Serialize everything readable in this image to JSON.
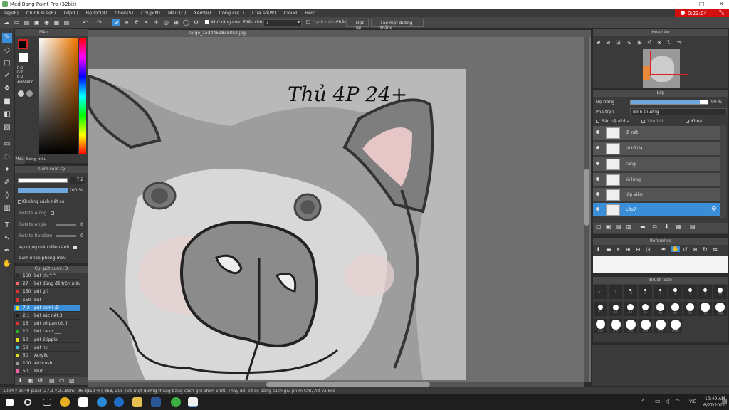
{
  "window": {
    "title": "MediBang Paint Pro (32bit)",
    "minimize": "–",
    "maximize": "□",
    "close": "✕"
  },
  "menu": [
    "Tệp(F)",
    "Chỉnh sửa(E)",
    "Lớp(L)",
    "Bộ lọc(R)",
    "Chọn(S)",
    "Chụp(N)",
    "Màu (C)",
    "Xem(V)",
    "Công cụ(T)",
    "Cửa sổ(W)",
    "Cloud",
    "Help"
  ],
  "recorder": {
    "time": "0:23:04"
  },
  "toolbar": {
    "anti_alias": "Khử răng cưa",
    "correction_label": "Điều chỉnh",
    "correction_value": "1",
    "edge": "Cạnh mềm",
    "pen_label": "Phẩn",
    "fill_label": "Đặt lại",
    "ruler_btn": "Tạo một đường thẳng"
  },
  "sheet": {
    "tab": "large_1524452835852.jpg"
  },
  "color_panel": {
    "title": "Màu",
    "r": "R:0",
    "g": "G:0",
    "b": "B:0",
    "hex": "#000000",
    "tab_color": "Màu",
    "tab_palette": "Bảng màu"
  },
  "brush_control": {
    "title": "Kiểm soát cọ",
    "size_value": "7.2",
    "opacity_value": "100 %",
    "spacing": "Khoảng cách nét cọ",
    "rotate_along": "Rotate Along",
    "rotate_angle": "Rotate Angle",
    "rotate_angle_val": "0",
    "rotate_random": "Rotate Random",
    "rotate_random_val": "0",
    "apply_color": "Áp dụng màu tiền cảnh",
    "blur": "Làm nhòe phóng màu"
  },
  "brush_list": {
    "title": "Cọ: pút sumi :D",
    "items": [
      {
        "size": "150",
        "name": "bút chì^^",
        "color": "#2a2a2a"
      },
      {
        "size": "27",
        "name": "bút dùng để trộn màu",
        "color": "#ff6666"
      },
      {
        "size": "150",
        "name": "pút gì?",
        "color": "#e03030"
      },
      {
        "size": "150",
        "name": "bút",
        "color": "#e03030"
      },
      {
        "size": "7.2",
        "name": "pút sumi :D",
        "color": "#e0e020"
      },
      {
        "size": "2.1",
        "name": "bút sắc nét:3",
        "color": "#1a1a1a"
      },
      {
        "size": "15",
        "name": "pút zẽ pán tốt:)",
        "color": "#e03030"
      },
      {
        "size": "10",
        "name": "bút cạnh ___",
        "color": "#20b020"
      },
      {
        "size": "50",
        "name": "pút Stipple",
        "color": "#e0e020"
      },
      {
        "size": "50",
        "name": "pút nc",
        "color": "#40c0e0"
      },
      {
        "size": "50",
        "name": "Acrylic",
        "color": "#e0e020"
      },
      {
        "size": "100",
        "name": "Airbrush",
        "color": "#999999"
      },
      {
        "size": "50",
        "name": "Blur",
        "color": "#ff66aa"
      }
    ]
  },
  "navigator": {
    "title": "Hoa tiêu"
  },
  "layer_panel": {
    "title": "Lớp",
    "opacity_label": "Độ trong",
    "opacity_value": "90 %",
    "opacity_fraction": 0.9,
    "blend_label": "Pha trộn",
    "blend_value": "Bình thường",
    "protect_alpha": "Bảo vệ alpha",
    "clipping": "Xén bớt",
    "lock": "Khóa",
    "layers": [
      {
        "name": "đi nét"
      },
      {
        "name": "tô tổ tỉa"
      },
      {
        "name": "răng"
      },
      {
        "name": "tô lông"
      },
      {
        "name": "lớp viền"
      },
      {
        "name": "Lớp7",
        "selected": true
      }
    ]
  },
  "reference": {
    "title": "Reference"
  },
  "brush_size": {
    "title": "Brush Size",
    "sizes": [
      "0.7",
      "1",
      "1.5",
      "2",
      "3",
      "4",
      "5",
      "7",
      "10",
      "12",
      "15",
      "20",
      "25",
      "30",
      "40",
      "50",
      "70",
      "100",
      "150",
      "200",
      "300",
      "400",
      "500",
      "1000"
    ]
  },
  "canvas_text": {
    "handwriting": "Thủ 4P 24+"
  },
  "status": {
    "size": "1024 * 1049 pixel  (27.1 * 27.8cm)  96 dpi",
    "zoom": "119 %",
    "coords": "( 868, 305 )",
    "hint": "Vẽ một đường thẳng bằng cách giữ phím Shift, Thay đổi cỡ cọ bằng cách giữ phím Ctrl, Alt và kéo"
  },
  "taskbar": {
    "time": "10:49 AM",
    "date": "6/27/2021",
    "lang": "VIE"
  }
}
